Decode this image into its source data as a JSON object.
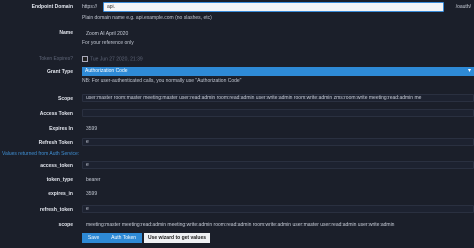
{
  "endpoint": {
    "label": "Endpoint Domain",
    "prefix": "https://",
    "value": "api.",
    "suffix": "/oauth/",
    "hint": "Plain domain name e.g. api.example.com (no slashes, etc)"
  },
  "name": {
    "label": "Name",
    "value": "Zoom AI April 2020",
    "hint": "For your reference only"
  },
  "token_expires": {
    "label": "Token Expires?",
    "value": "Tue Jun 27 2020, 21:39"
  },
  "grant_type": {
    "label": "Grant Type",
    "value": "Authorization Code",
    "note": "NB: For user-authenticated calls, you normally use \"Authorization Code\""
  },
  "scope": {
    "label": "Scope",
    "value": "user:master room:master meeting:master user:read:admin room:read:admin user:write:admin room:write:admin zms:room:write meeting:read:admin me"
  },
  "access_token": {
    "label": "Access Token",
    "value": ""
  },
  "expires_in": {
    "label": "Expires In",
    "value": "3599"
  },
  "refresh_token": {
    "label": "Refresh Token",
    "value": "e"
  },
  "auth_section": {
    "label": "Values returned from Auth Service:"
  },
  "returned": {
    "access_token": {
      "label": "access_token",
      "value": "e"
    },
    "token_type": {
      "label": "token_type",
      "value": "bearer"
    },
    "expires_in": {
      "label": "expires_in",
      "value": "3599"
    },
    "refresh_token": {
      "label": "refresh_token",
      "value": "e"
    },
    "scope": {
      "label": "scope",
      "value": "meeting:master meeting:read:admin meeting:write:admin room:read:admin room:write:admin user:master user:read:admin user:write:admin"
    }
  },
  "buttons": {
    "save": "Save",
    "auth_token": "Auth Token",
    "wizard": "Use wizard to get values"
  },
  "colors": {
    "accent": "#2e8ad6",
    "background": "#1b1f2a"
  }
}
